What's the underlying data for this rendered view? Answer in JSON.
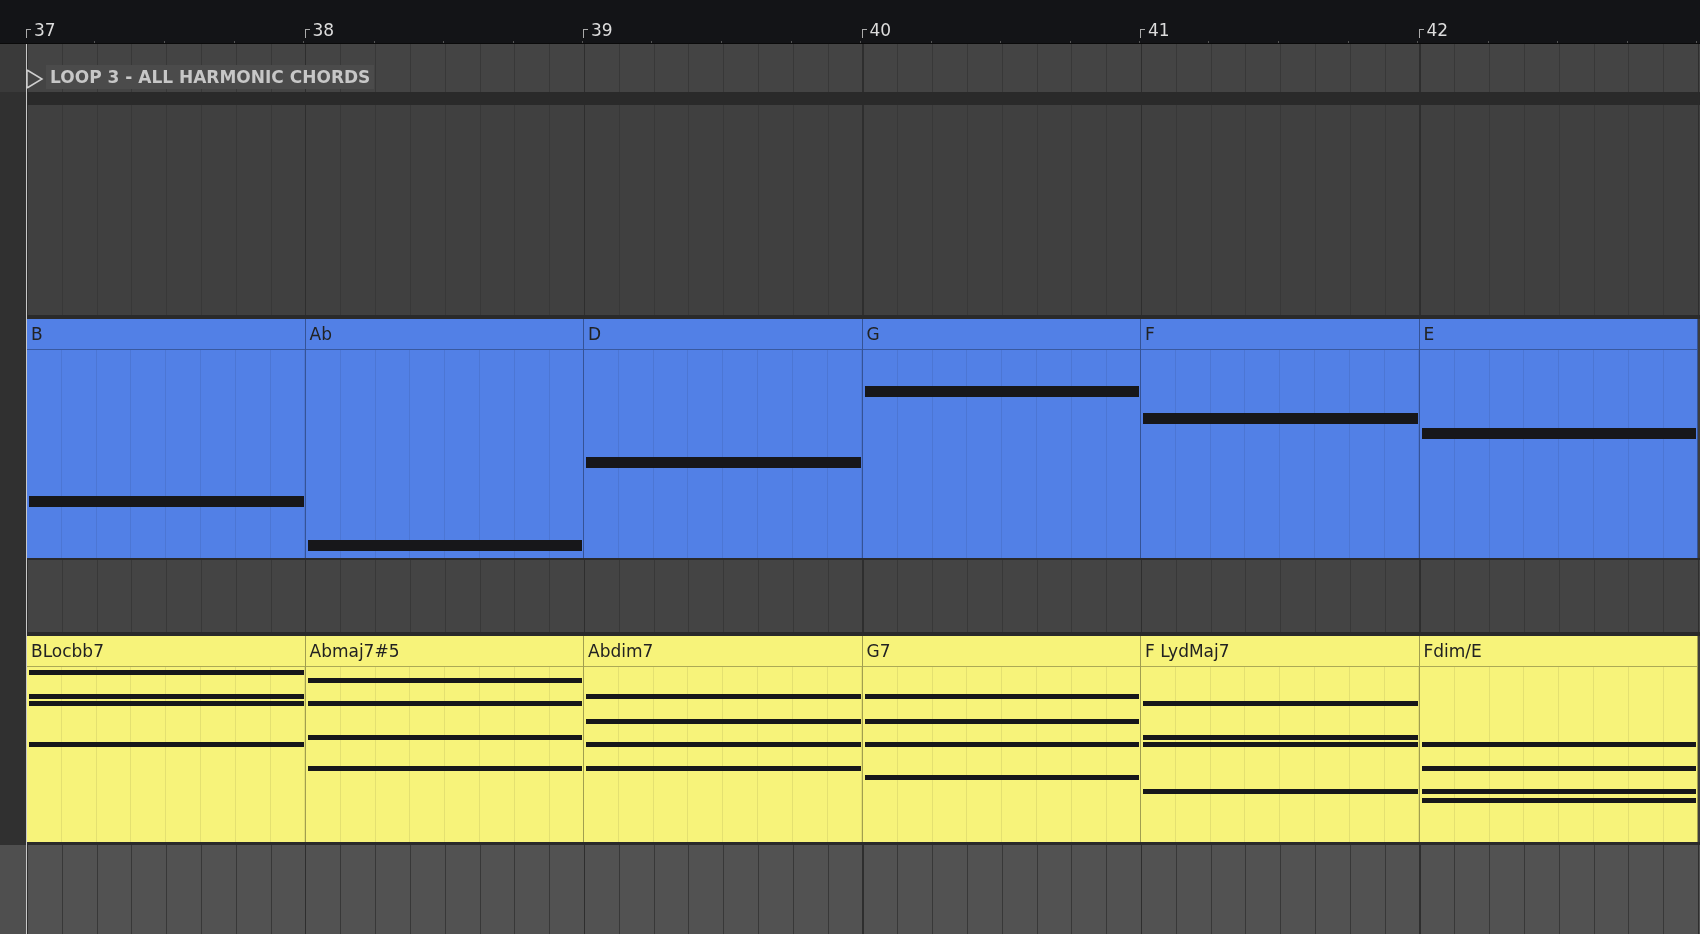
{
  "ruler": {
    "bar_numbers": [
      "37",
      "38",
      "39",
      "40",
      "41",
      "42"
    ]
  },
  "locator": {
    "label": "LOOP 3 - ALL HARMONIC CHORDS"
  },
  "tracks": [
    {
      "kind": "empty"
    },
    {
      "kind": "midi",
      "color": "#5280e6",
      "clips": [
        {
          "name": "B"
        },
        {
          "name": "Ab"
        },
        {
          "name": "D"
        },
        {
          "name": "G"
        },
        {
          "name": "F"
        },
        {
          "name": "E"
        }
      ]
    },
    {
      "kind": "empty"
    },
    {
      "kind": "midi",
      "color": "#f7f37a",
      "clips": [
        {
          "name": "BLocbb7"
        },
        {
          "name": "Abmaj7#5"
        },
        {
          "name": "Abdim7"
        },
        {
          "name": "G7"
        },
        {
          "name": "F LydMaj7"
        },
        {
          "name": "Fdim/E"
        }
      ]
    }
  ]
}
